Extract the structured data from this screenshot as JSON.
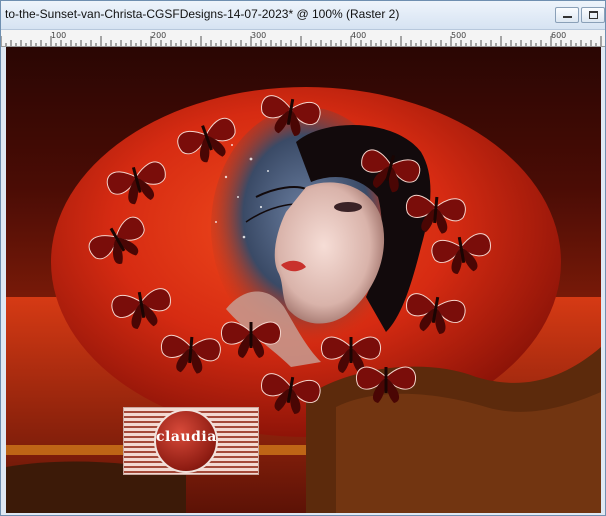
{
  "window": {
    "title": "to-the-Sunset-van-Christa-CGSFDesigns-14-07-2023* @ 100% (Raster 2)"
  },
  "ruler": {
    "labels": [
      "100",
      "200",
      "300",
      "400",
      "500",
      "600"
    ]
  },
  "watermark": {
    "text": "claudia"
  },
  "colors": {
    "moon": "#d62b12",
    "sky_dark": "#2a0603",
    "butterfly": "#7a0d0a",
    "foliage": "#5c2a0c"
  }
}
